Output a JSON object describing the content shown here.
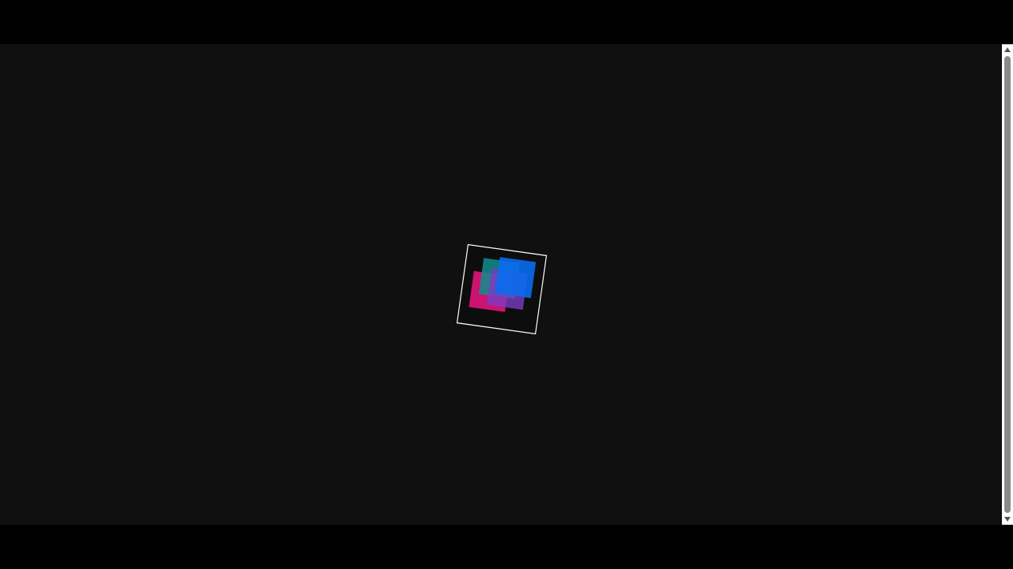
{
  "viewport": {
    "background": "#101010",
    "letterbox": "#000000"
  },
  "artwork": {
    "frame_stroke": "#ffffff",
    "squares": [
      {
        "name": "magenta-square",
        "color": "#e0147a"
      },
      {
        "name": "teal-square",
        "color": "#138d8d"
      },
      {
        "name": "purple-square",
        "color": "#7a3cc4"
      },
      {
        "name": "blue-square",
        "color": "#0a6cf0"
      }
    ]
  },
  "scrollbar": {
    "track": "#ffffff",
    "thumb": "#8a8a8a",
    "arrows": "#555555",
    "position": 0
  }
}
